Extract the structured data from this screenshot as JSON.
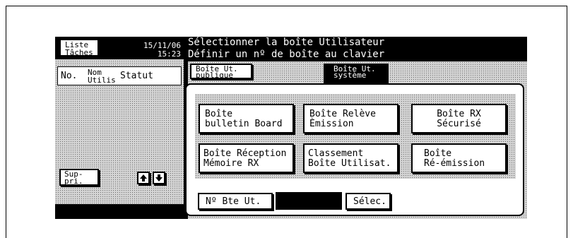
{
  "left_panel": {
    "job_list_button": "Liste\nTâches",
    "date": "15/11/06",
    "time": "15:23",
    "columns": {
      "no": "No.",
      "name": "Nom\nUtilis",
      "status": "Statut"
    },
    "delete_button": "Sup-\npri.",
    "scroll_up_icon": "arrow-up-icon",
    "scroll_down_icon": "arrow-down-icon"
  },
  "header": {
    "line1": "Sélectionner la boîte Utilisateur",
    "line2": "Définir un nº de boîte au clavier"
  },
  "tabs": [
    {
      "label": "Boîte Ut.\npublique",
      "active": false
    },
    {
      "label": "Boîte Ut.\nsystème",
      "active": true
    }
  ],
  "boxes": [
    {
      "label": "Boîte\nbulletin Board"
    },
    {
      "label": "Boîte Relève\nÈmission"
    },
    {
      "label": "Boîte RX\nSécurisé"
    },
    {
      "label": "Boîte Réception\nMémoire RX"
    },
    {
      "label": "Classement\nBoîte Utilisat."
    },
    {
      "label": "Boîte\nRé-émission"
    }
  ],
  "bottom": {
    "box_number_button": "Nº Bte Ut.",
    "box_number_value": "",
    "select_button": "Sélec."
  },
  "colors": {
    "screen": "#000000",
    "pattern": "#d4d4d4",
    "button": "#ffffff"
  }
}
